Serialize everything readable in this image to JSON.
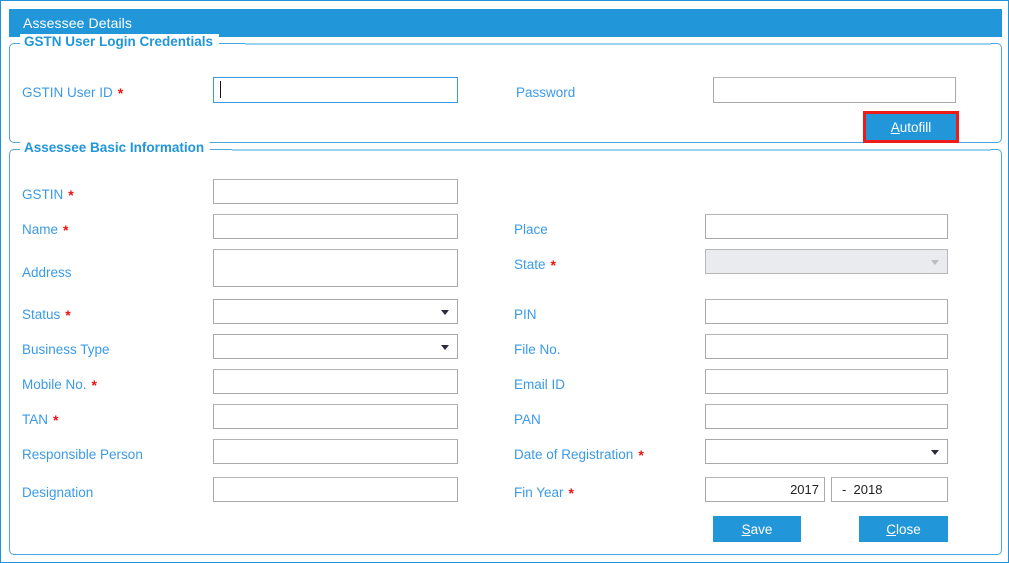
{
  "window": {
    "title": "Assessee Details",
    "accent_color": "#2196d9",
    "label_color": "#3b9ae8",
    "required_marker_color": "#ee1111",
    "highlight_color": "#ee1b1b"
  },
  "credentials_section": {
    "legend": "GSTN User Login Credentials",
    "fields": [
      {
        "label": "GSTIN User ID",
        "required": "*",
        "value": "",
        "type": "text",
        "focused": true
      },
      {
        "label": "Password",
        "required": "",
        "value": "",
        "type": "password",
        "focused": false
      }
    ],
    "autofill_button": {
      "label": "Autofill",
      "mnemonic": "A",
      "rest": "utofill",
      "highlighted": true
    }
  },
  "basic_section": {
    "legend": "Assessee Basic Information",
    "left_fields": [
      {
        "label": "GSTIN",
        "required": "*",
        "value": "",
        "type": "text"
      },
      {
        "label": "Name",
        "required": "*",
        "value": "",
        "type": "text"
      },
      {
        "label": "Address",
        "required": "",
        "value": "",
        "type": "textarea"
      },
      {
        "label": "Status",
        "required": "*",
        "value": "",
        "type": "combo",
        "disabled": false
      },
      {
        "label": "Business Type",
        "required": "",
        "value": "",
        "type": "combo",
        "disabled": false
      },
      {
        "label": "Mobile No.",
        "required": "*",
        "value": "",
        "type": "text"
      },
      {
        "label": "TAN",
        "required": "*",
        "value": "",
        "type": "text"
      },
      {
        "label": "Responsible Person",
        "required": "",
        "value": "",
        "type": "text"
      },
      {
        "label": "Designation",
        "required": "",
        "value": "",
        "type": "text"
      }
    ],
    "right_fields": [
      {
        "label": "Place",
        "required": "",
        "value": "",
        "type": "text"
      },
      {
        "label": "State",
        "required": "*",
        "value": "",
        "type": "combo",
        "disabled": true
      },
      {
        "label": "PIN",
        "required": "",
        "value": "",
        "type": "text"
      },
      {
        "label": "File No.",
        "required": "",
        "value": "",
        "type": "text"
      },
      {
        "label": "Email ID",
        "required": "",
        "value": "",
        "type": "text"
      },
      {
        "label": "PAN",
        "required": "",
        "value": "",
        "type": "text"
      },
      {
        "label": "Date of Registration",
        "required": "*",
        "value": "",
        "type": "combo",
        "disabled": false
      }
    ],
    "fin_year": {
      "label": "Fin Year",
      "required": "*",
      "start_value": "2017",
      "separator": "-",
      "end_value": "2018"
    },
    "save_button": {
      "label": "Save",
      "mnemonic": "S",
      "rest": "ave"
    },
    "close_button": {
      "label": "Close",
      "mnemonic": "C",
      "rest": "lose"
    }
  }
}
